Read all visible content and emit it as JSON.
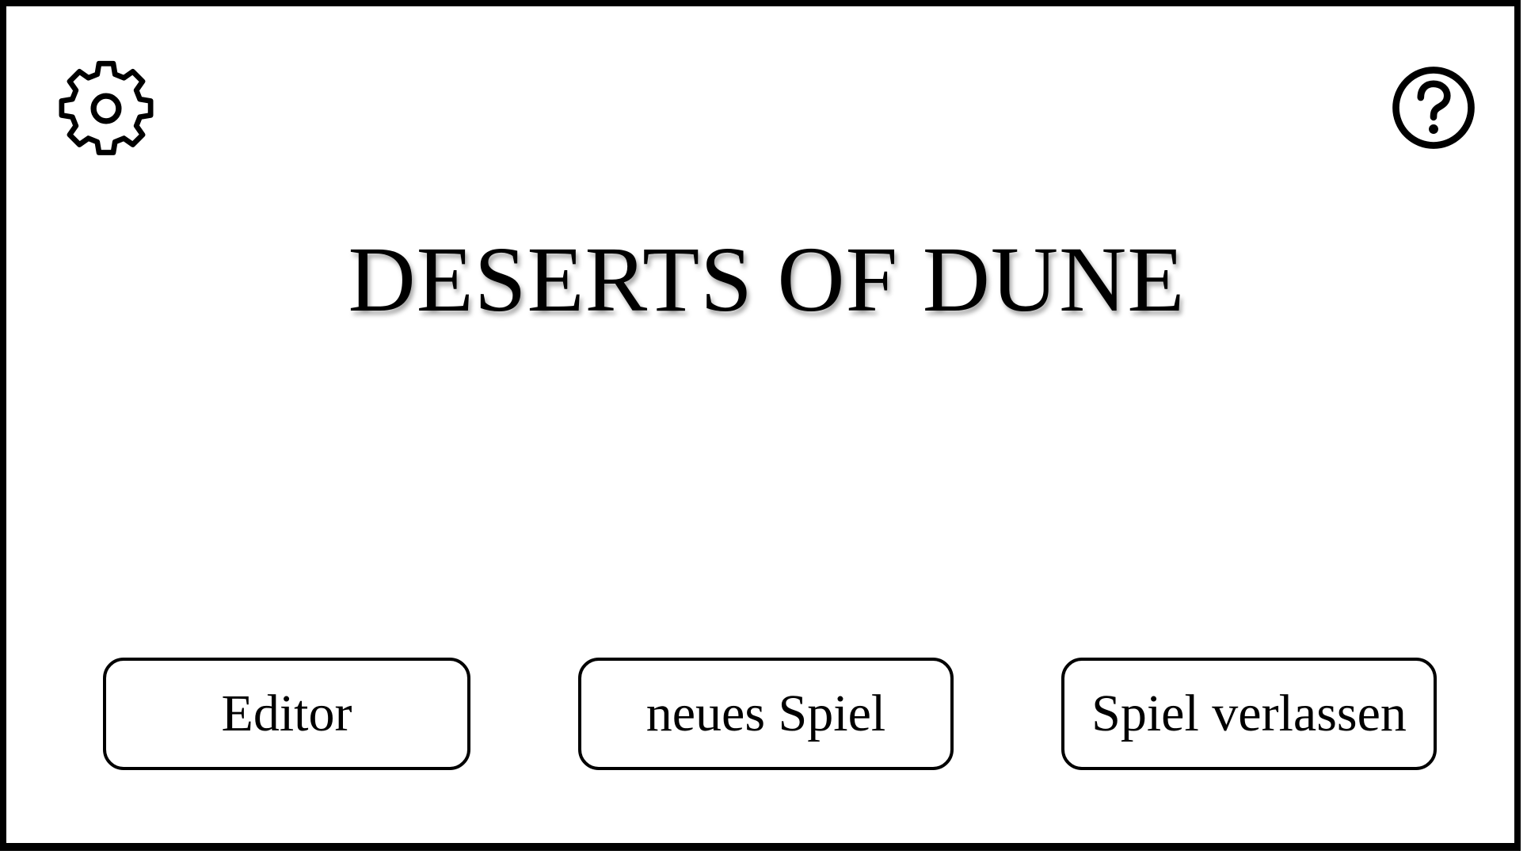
{
  "app": {
    "title": "DESERTS OF DUNE"
  },
  "toolbar": {
    "settings_icon": "gear-icon",
    "help_icon": "question-circle-icon"
  },
  "menu": {
    "buttons": [
      {
        "label": "Editor"
      },
      {
        "label": "neues Spiel"
      },
      {
        "label": "Spiel verlassen"
      }
    ]
  },
  "colors": {
    "background": "#ffffff",
    "foreground": "#000000"
  }
}
